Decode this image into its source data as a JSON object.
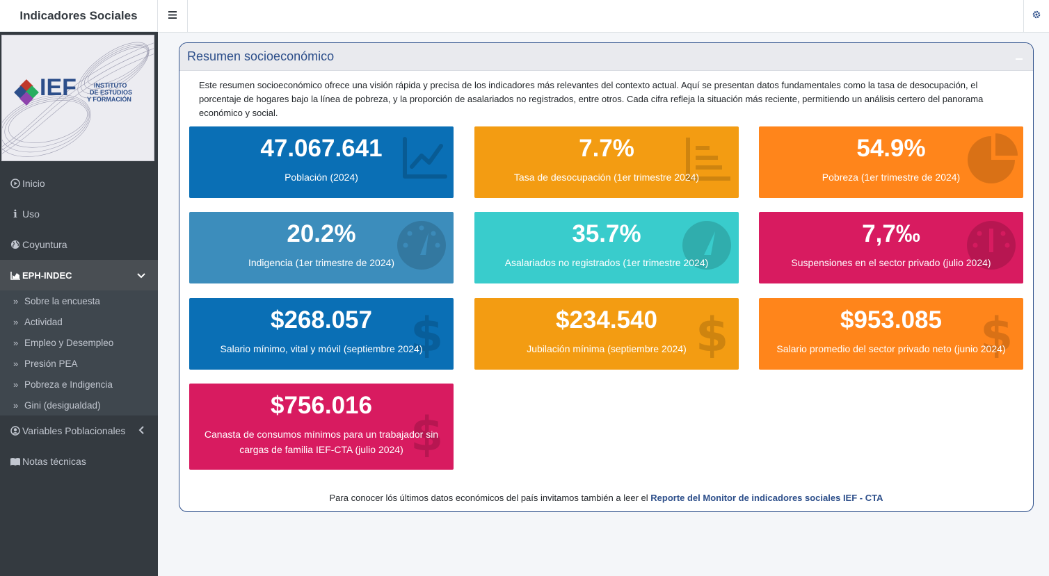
{
  "app": {
    "title": "Indicadores Sociales"
  },
  "sidebar": {
    "logo": {
      "name": "IEF",
      "text_line1": "INSTITUTO",
      "text_line2": "DE ESTUDIOS",
      "text_line3": "Y FORMACIÓN"
    },
    "items": [
      {
        "label": "Inicio",
        "icon": "play-circle-icon"
      },
      {
        "label": "Uso",
        "icon": "info-icon"
      },
      {
        "label": "Coyuntura",
        "icon": "globe-icon"
      },
      {
        "label": "EPH-INDEC",
        "icon": "chart-area-icon"
      }
    ],
    "subitems": [
      {
        "label": "Sobre la encuesta"
      },
      {
        "label": "Actividad"
      },
      {
        "label": "Empleo y Desempleo"
      },
      {
        "label": "Presión PEA"
      },
      {
        "label": "Pobreza e Indigencia"
      },
      {
        "label": "Gini (desigualdad)"
      }
    ],
    "bottom_items": [
      {
        "label": "Variables Poblacionales",
        "icon": "user-circle-icon"
      },
      {
        "label": "Notas técnicas",
        "icon": "book-icon"
      }
    ]
  },
  "card": {
    "title": "Resumen socioeconómico",
    "intro": "Este resumen socioeconómico ofrece una visión rápida y precisa de los indicadores más relevantes del contexto actual. Aquí se presentan datos fundamentales como la tasa de desocupación, el porcentaje de hogares bajo la línea de pobreza, y la proporción de asalariados no registrados, entre otros. Cada cifra refleja la situación más reciente, permitiendo un análisis certero del panorama económico y social.",
    "boxes": [
      {
        "value": "47.067.641",
        "label": "Población (2024)",
        "color": "#0a6fb5",
        "icon": "line-chart-icon"
      },
      {
        "value": "7.7%",
        "label": "Tasa de desocupación (1er trimestre 2024)",
        "color": "#f39c12",
        "icon": "bar-list-icon"
      },
      {
        "value": "54.9%",
        "label": "Pobreza (1er trimestre de 2024)",
        "color": "#ff851b",
        "icon": "pie-chart-icon"
      },
      {
        "value": "20.2%",
        "label": "Indigencia (1er trimestre de 2024)",
        "color": "#3c8dbc",
        "icon": "gauge-icon"
      },
      {
        "value": "35.7%",
        "label": "Asalariados no registrados (1er trimestre 2024)",
        "color": "#39cccc",
        "icon": "gauge-icon"
      },
      {
        "value": "7,7‰",
        "label": "Suspensiones en el sector privado (julio 2024)",
        "color": "#d81b60",
        "icon": "gauge-icon"
      },
      {
        "value": "$268.057",
        "label": "Salario mínimo, vital y móvil (septiembre 2024)",
        "color": "#0a6fb5",
        "icon": "dollar-icon"
      },
      {
        "value": "$234.540",
        "label": "Jubilación mínima (septiembre 2024)",
        "color": "#f39c12",
        "icon": "dollar-icon"
      },
      {
        "value": "$953.085",
        "label": "Salario promedio del sector privado neto (junio 2024)",
        "color": "#ff851b",
        "icon": "dollar-icon"
      },
      {
        "value": "$756.016",
        "label": "Canasta de consumos mínimos para un trabajador sin cargas de familia IEF-CTA (julio 2024)",
        "color": "#d81b60",
        "icon": "dollar-icon"
      }
    ],
    "footer_text": "Para conocer lós últimos datos económicos del país invitamos también a leer el",
    "footer_link": "Reporte del Monitor de indicadores sociales IEF - CTA"
  }
}
